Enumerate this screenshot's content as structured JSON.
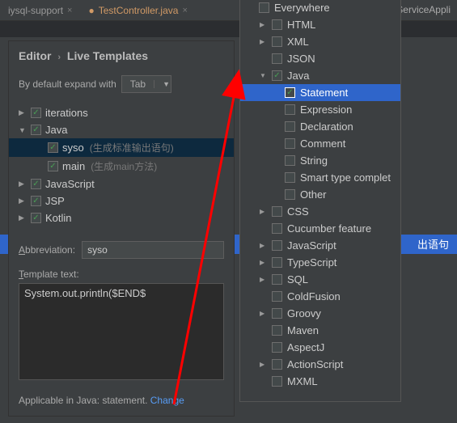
{
  "tabs": [
    {
      "label": "iysql-support",
      "active": false
    },
    {
      "label": "TestController.java",
      "active": true
    }
  ],
  "top_right_text": "rderServiceAppli",
  "breadcrumb": {
    "section": "Editor",
    "page": "Live Templates"
  },
  "expand": {
    "prefix": "By default expand with",
    "value": "Tab"
  },
  "tree": [
    {
      "label": "iterations",
      "level": 1,
      "expander": "▶",
      "checked": true
    },
    {
      "label": "Java",
      "level": 1,
      "expander": "▼",
      "checked": true
    },
    {
      "label": "syso",
      "hint": "(生成标准输出语句)",
      "level": 3,
      "checked": true,
      "selected": true
    },
    {
      "label": "main",
      "hint": "(生成main方法)",
      "level": 3,
      "checked": true
    },
    {
      "label": "JavaScript",
      "level": 1,
      "expander": "▶",
      "checked": true
    },
    {
      "label": "JSP",
      "level": 1,
      "expander": "▶",
      "checked": true
    },
    {
      "label": "Kotlin",
      "level": 1,
      "expander": "▶",
      "checked": true
    }
  ],
  "abbrev": {
    "label_pre": "A",
    "label_post": "bbreviation:",
    "value": "syso"
  },
  "template": {
    "label_pre": "T",
    "label_post": "emplate text:",
    "value": "System.out.println($END$"
  },
  "applicable": {
    "text": "Applicable in Java: statement.",
    "link": "Change"
  },
  "popup": [
    {
      "label": "Everywhere",
      "level": 0,
      "checked": false,
      "expander": ""
    },
    {
      "label": "HTML",
      "level": 1,
      "checked": false,
      "expander": "▶"
    },
    {
      "label": "XML",
      "level": 1,
      "checked": false,
      "expander": "▶"
    },
    {
      "label": "JSON",
      "level": 1,
      "checked": false,
      "expander": ""
    },
    {
      "label": "Java",
      "level": 1,
      "checked": true,
      "expander": "▼"
    },
    {
      "label": "Statement",
      "level": 2,
      "checked": true,
      "selected": true
    },
    {
      "label": "Expression",
      "level": 2,
      "checked": false
    },
    {
      "label": "Declaration",
      "level": 2,
      "checked": false
    },
    {
      "label": "Comment",
      "level": 2,
      "checked": false
    },
    {
      "label": "String",
      "level": 2,
      "checked": false
    },
    {
      "label": "Smart type complet",
      "level": 2,
      "checked": false
    },
    {
      "label": "Other",
      "level": 2,
      "checked": false
    },
    {
      "label": "CSS",
      "level": 1,
      "checked": false,
      "expander": "▶"
    },
    {
      "label": "Cucumber feature",
      "level": 1,
      "checked": false,
      "expander": ""
    },
    {
      "label": "JavaScript",
      "level": 1,
      "checked": false,
      "expander": "▶"
    },
    {
      "label": "TypeScript",
      "level": 1,
      "checked": false,
      "expander": "▶"
    },
    {
      "label": "SQL",
      "level": 1,
      "checked": false,
      "expander": "▶"
    },
    {
      "label": "ColdFusion",
      "level": 1,
      "checked": false,
      "expander": ""
    },
    {
      "label": "Groovy",
      "level": 1,
      "checked": false,
      "expander": "▶"
    },
    {
      "label": "Maven",
      "level": 1,
      "checked": false,
      "expander": ""
    },
    {
      "label": "AspectJ",
      "level": 1,
      "checked": false,
      "expander": ""
    },
    {
      "label": "ActionScript",
      "level": 1,
      "checked": false,
      "expander": "▶"
    },
    {
      "label": "MXML",
      "level": 1,
      "checked": false,
      "expander": ""
    }
  ],
  "right_highlight_text": "出语句"
}
